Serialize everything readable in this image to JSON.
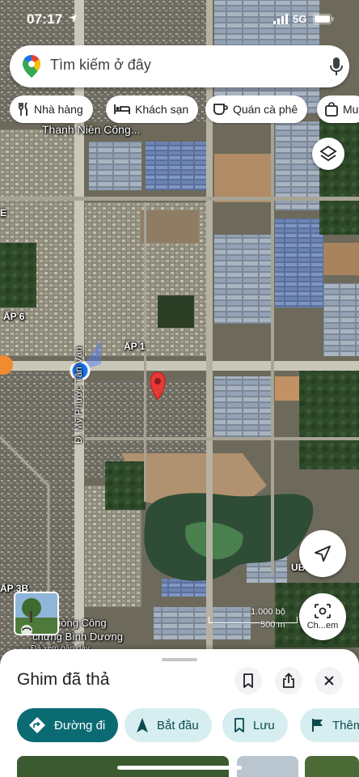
{
  "status": {
    "time": "07:17",
    "network": "5G"
  },
  "search": {
    "placeholder": "Tìm kiếm ở đây"
  },
  "chips": [
    {
      "label": "Nhà hàng",
      "icon": "fork-knife-icon"
    },
    {
      "label": "Khách sạn",
      "icon": "bed-icon"
    },
    {
      "label": "Quán cà phê",
      "icon": "coffee-cup-icon"
    },
    {
      "label": "Mu",
      "icon": "shopping-bag-icon"
    }
  ],
  "map": {
    "labels": {
      "place_top": "Thanh Niên Công...",
      "area_ap6": "ẤP 6",
      "area_ap1": "ẤP 1",
      "area_ap3b": "ẤP 3B",
      "road": "Đ. Mỹ Phước Tân Vạn",
      "edge_e": "E",
      "ub": "UB",
      "place_bottom_1": "hòng Công",
      "place_bottom_2": "chứng Bình Dương",
      "place_bottom_3": "Đã xem gần đây"
    },
    "scale": {
      "imperial": "1.000 bộ",
      "metric": "500 m"
    },
    "colors": {
      "pin": "#e53935",
      "location_dot": "#1a73e8"
    }
  },
  "lens": {
    "label": "Ch...em"
  },
  "sheet": {
    "title": "Ghim đã thả",
    "actions": {
      "directions": "Đường đi",
      "start": "Bắt đầu",
      "save": "Lưu",
      "more": "Thêm"
    },
    "accent_color": "#0b6b73"
  }
}
